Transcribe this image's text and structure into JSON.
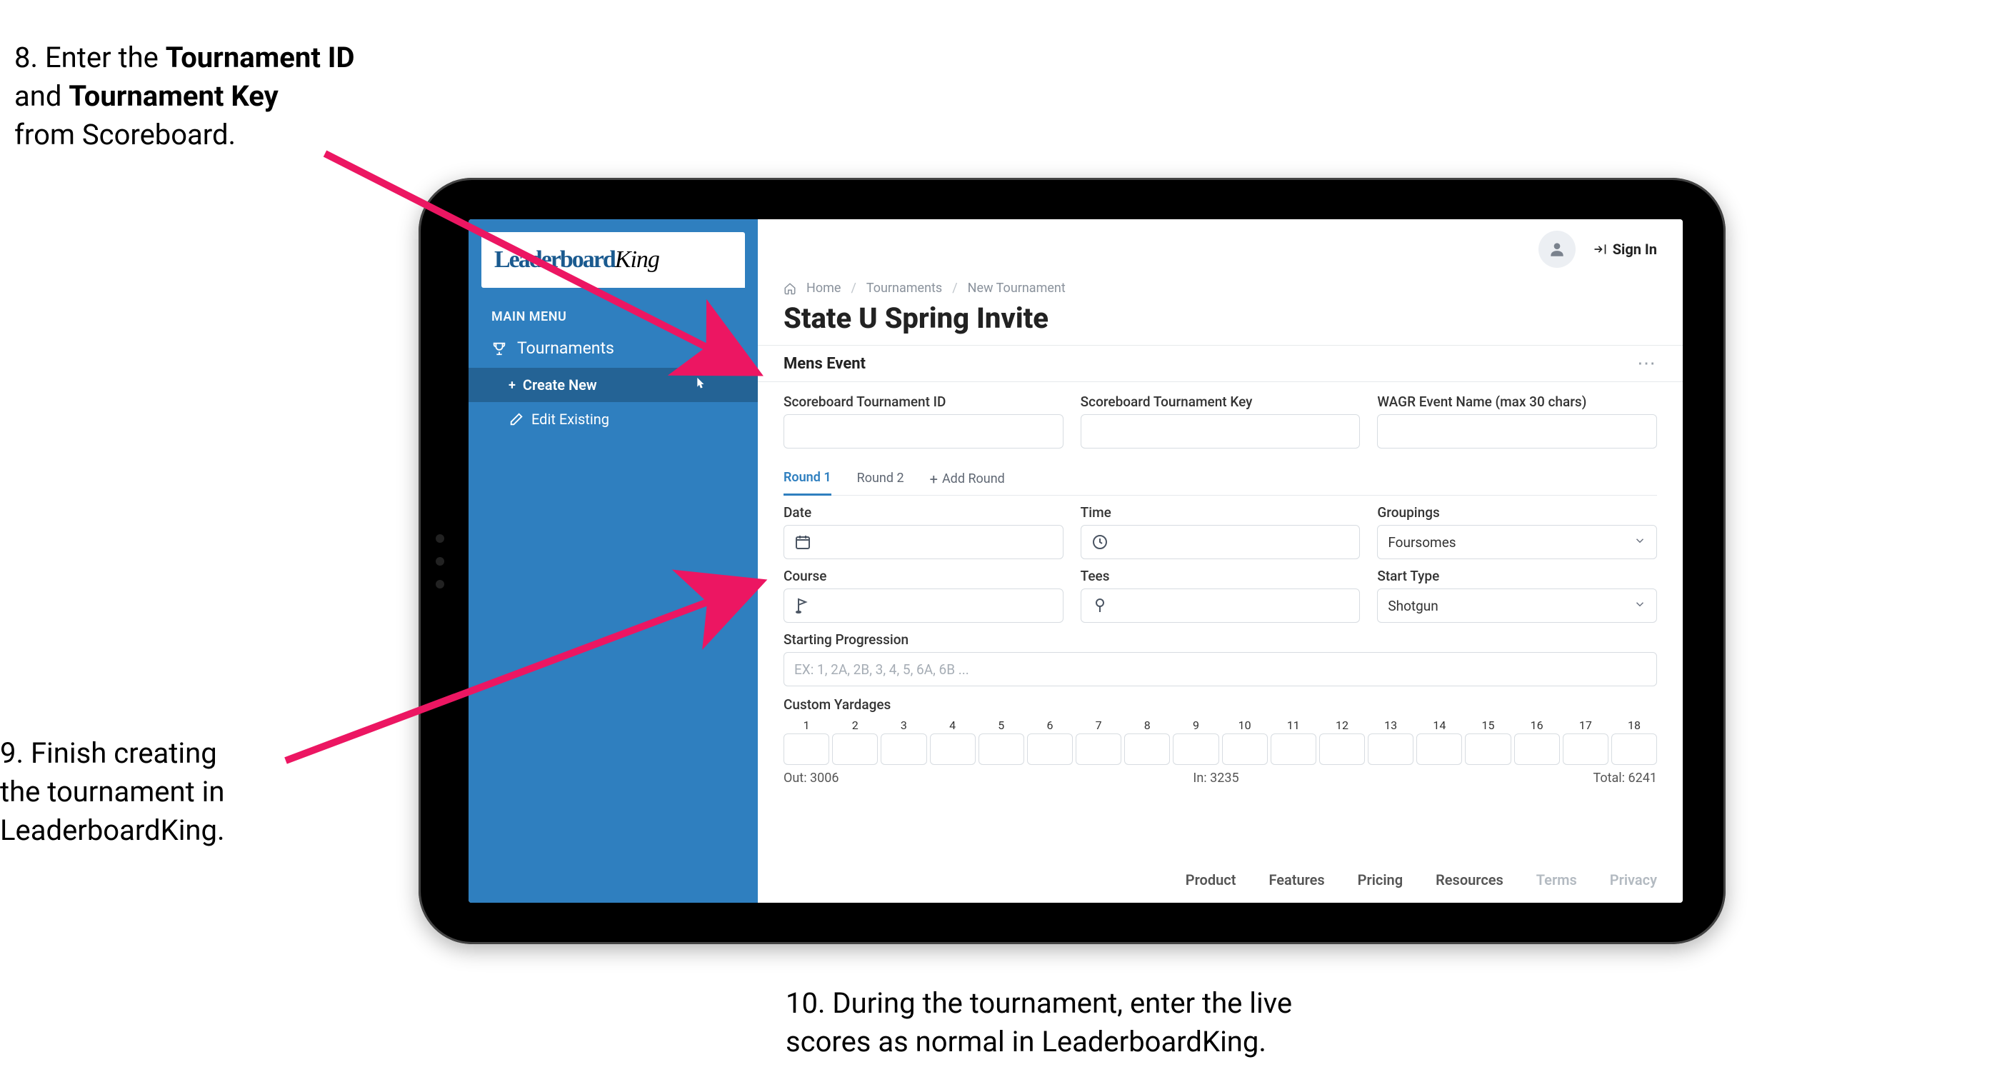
{
  "annotations": {
    "step8_line1_a": "8. Enter the ",
    "step8_line1_b": "Tournament ID",
    "step8_line2_a": "and ",
    "step8_line2_b": "Tournament Key",
    "step8_line3": "from Scoreboard.",
    "step9_line1": "9. Finish creating",
    "step9_line2": "the tournament in",
    "step9_line3": "LeaderboardKing.",
    "step10_line1": "10. During the tournament, enter the live",
    "step10_line2": "scores as normal in LeaderboardKing."
  },
  "sidebar": {
    "logo_text": "LeaderboardKing",
    "main_menu_label": "MAIN MENU",
    "tournaments_label": "Tournaments",
    "create_new_label": "Create New",
    "edit_existing_label": "Edit Existing"
  },
  "topbar": {
    "sign_in_label": "Sign In"
  },
  "breadcrumb": {
    "home": "Home",
    "tournaments": "Tournaments",
    "new_tournament": "New Tournament"
  },
  "page_title": "State U Spring Invite",
  "section": {
    "title": "Mens Event"
  },
  "fields": {
    "scoreboard_id_label": "Scoreboard Tournament ID",
    "scoreboard_key_label": "Scoreboard Tournament Key",
    "wagr_label": "WAGR Event Name (max 30 chars)",
    "date_label": "Date",
    "time_label": "Time",
    "groupings_label": "Groupings",
    "groupings_value": "Foursomes",
    "course_label": "Course",
    "tees_label": "Tees",
    "start_type_label": "Start Type",
    "start_type_value": "Shotgun",
    "starting_progression_label": "Starting Progression",
    "starting_progression_placeholder": "EX: 1, 2A, 2B, 3, 4, 5, 6A, 6B ...",
    "custom_yardages_label": "Custom Yardages"
  },
  "rounds": {
    "round1": "Round 1",
    "round2": "Round 2",
    "add_round": "Add Round"
  },
  "yardages": {
    "holes": [
      "1",
      "2",
      "3",
      "4",
      "5",
      "6",
      "7",
      "8",
      "9",
      "10",
      "11",
      "12",
      "13",
      "14",
      "15",
      "16",
      "17",
      "18"
    ],
    "out_label": "Out:",
    "out_value": "3006",
    "in_label": "In:",
    "in_value": "3235",
    "total_label": "Total:",
    "total_value": "6241"
  },
  "footer": {
    "product": "Product",
    "features": "Features",
    "pricing": "Pricing",
    "resources": "Resources",
    "terms": "Terms",
    "privacy": "Privacy"
  },
  "colors": {
    "accent_blue": "#2f7fbf",
    "arrow_pink": "#ec1662"
  }
}
